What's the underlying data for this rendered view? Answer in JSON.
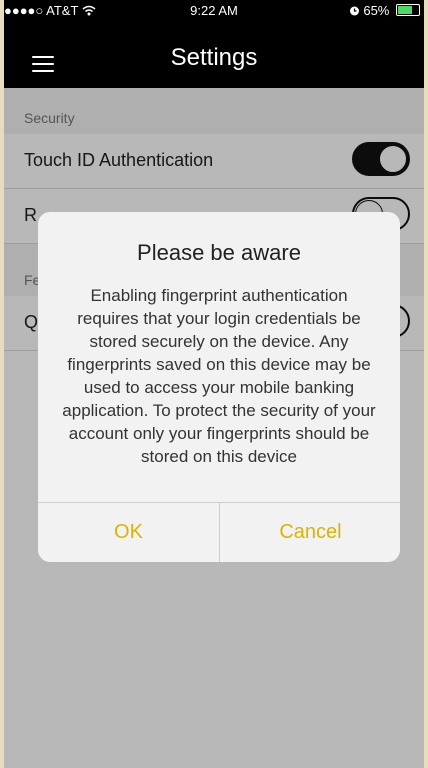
{
  "status_bar": {
    "carrier": "●●●●○ AT&T",
    "wifi_icon": "wifi-icon",
    "time": "9:22 AM",
    "alarm_icon": "alarm-icon",
    "battery_percent": "65%",
    "battery_level": 0.65
  },
  "nav": {
    "menu_icon": "hamburger-menu-icon",
    "title": "Settings"
  },
  "sections": {
    "security": {
      "header": "Security",
      "rows": [
        {
          "label": "Touch ID Authentication",
          "toggle": true
        },
        {
          "label": "R",
          "toggle": false
        }
      ]
    },
    "features": {
      "header": "Fe",
      "rows": [
        {
          "label": "Q",
          "toggle": false
        }
      ]
    }
  },
  "dialog": {
    "title": "Please be aware",
    "message": "Enabling fingerprint authentication requires that your login credentials be stored securely on the device. Any fingerprints saved on this device may be used to access your mobile banking application. To protect the security of your account only your fingerprints should be stored on this device",
    "ok_label": "OK",
    "cancel_label": "Cancel",
    "button_color": "#d9b500"
  },
  "colors": {
    "nav_background": "#000000",
    "accent": "#d9b500"
  }
}
